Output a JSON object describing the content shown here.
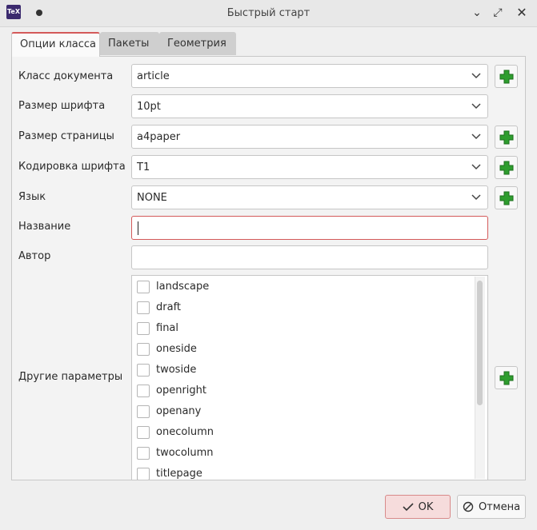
{
  "window": {
    "app_icon_text": "TeX",
    "title": "Быстрый старт"
  },
  "tabs": [
    {
      "label": "Опции класса",
      "active": true
    },
    {
      "label": "Пакеты",
      "active": false
    },
    {
      "label": "Геометрия",
      "active": false
    }
  ],
  "form": {
    "document_class": {
      "label": "Класс документа",
      "value": "article"
    },
    "font_size": {
      "label": "Размер шрифта",
      "value": "10pt"
    },
    "paper_size": {
      "label": "Размер страницы",
      "value": "a4paper"
    },
    "font_encoding": {
      "label": "Кодировка шрифта",
      "value": "T1"
    },
    "language": {
      "label": "Язык",
      "value": "NONE"
    },
    "title": {
      "label": "Название",
      "value": ""
    },
    "author": {
      "label": "Автор",
      "value": ""
    },
    "other_options": {
      "label": "Другие параметры",
      "items": [
        {
          "label": "landscape",
          "checked": false
        },
        {
          "label": "draft",
          "checked": false
        },
        {
          "label": "final",
          "checked": false
        },
        {
          "label": "oneside",
          "checked": false
        },
        {
          "label": "twoside",
          "checked": false
        },
        {
          "label": "openright",
          "checked": false
        },
        {
          "label": "openany",
          "checked": false
        },
        {
          "label": "onecolumn",
          "checked": false
        },
        {
          "label": "twocolumn",
          "checked": false
        },
        {
          "label": "titlepage",
          "checked": false
        }
      ]
    }
  },
  "buttons": {
    "ok_label": "OK",
    "cancel_label": "Отмена"
  },
  "colors": {
    "accent": "#d45a5a",
    "plus_green": "#2e9d2e",
    "ok_background": "#f6dcdc"
  },
  "icons": {
    "plus": "plus-icon",
    "check": "check-icon",
    "cancel": "cancel-icon",
    "chevron": "chevron-down-icon"
  }
}
